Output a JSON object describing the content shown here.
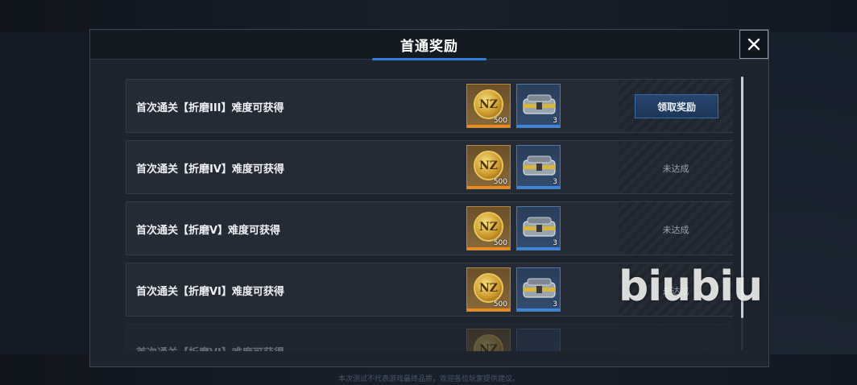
{
  "modal": {
    "title": "首通奖励",
    "close_glyph": "✕"
  },
  "rows": [
    {
      "label": "首次通关【折磨III】难度可获得",
      "coin_qty": "500",
      "chest_qty": "3",
      "status": "claimable",
      "button_label": "领取奖励",
      "status_text": ""
    },
    {
      "label": "首次通关【折磨IV】难度可获得",
      "coin_qty": "500",
      "chest_qty": "3",
      "status": "locked",
      "button_label": "",
      "status_text": "未达成"
    },
    {
      "label": "首次通关【折磨V】难度可获得",
      "coin_qty": "500",
      "chest_qty": "3",
      "status": "locked",
      "button_label": "",
      "status_text": "未达成"
    },
    {
      "label": "首次通关【折磨VI】难度可获得",
      "coin_qty": "500",
      "chest_qty": "3",
      "status": "locked",
      "button_label": "",
      "status_text": "未达成"
    },
    {
      "label": "首次通关【折磨VI】难度可获得",
      "coin_qty": "",
      "chest_qty": "",
      "status": "partially-visible",
      "button_label": "",
      "status_text": ""
    }
  ],
  "icons": {
    "coin": "nz-coin-icon",
    "chest": "supply-chest-icon",
    "coin_text": "NZ"
  },
  "colors": {
    "coin_bar": "#f08a1c",
    "chest_bar": "#3a86e0",
    "claim_button": "#27456e",
    "accent": "#2f7fd8"
  },
  "watermark": "biubiu",
  "background": {
    "footer_text": "本次测试不代表游戏最终品质，欢迎各位玩家提供建议。"
  }
}
